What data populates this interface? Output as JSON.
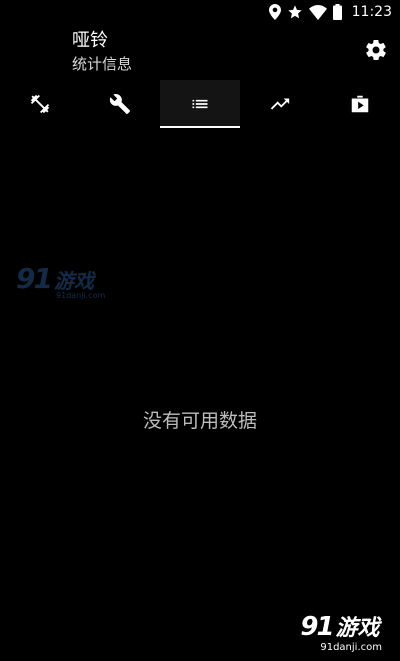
{
  "status_bar": {
    "time": "11:23",
    "icons": [
      "location-icon",
      "star-icon",
      "wifi-icon",
      "battery-icon"
    ]
  },
  "app_bar": {
    "title": "哑铃",
    "subtitle": "统计信息",
    "action_icon": "gear-icon"
  },
  "tabs": [
    {
      "icon": "dumbbell-icon",
      "active": false
    },
    {
      "icon": "wrench-icon",
      "active": false
    },
    {
      "icon": "list-icon",
      "active": true
    },
    {
      "icon": "trending-up-icon",
      "active": false
    },
    {
      "icon": "video-library-icon",
      "active": false
    }
  ],
  "main": {
    "empty_message": "没有可用数据"
  },
  "watermarks": {
    "top_number": "91",
    "top_text": "游戏",
    "top_url": "91danji.com",
    "bottom_number": "91",
    "bottom_text": "游戏",
    "bottom_url": "91danji.com"
  },
  "colors": {
    "background": "#000000",
    "active_tab_bg": "#141414",
    "indicator": "#ffffff",
    "empty_text": "#bdbdbd",
    "watermark_blue": "#3a78c8"
  }
}
